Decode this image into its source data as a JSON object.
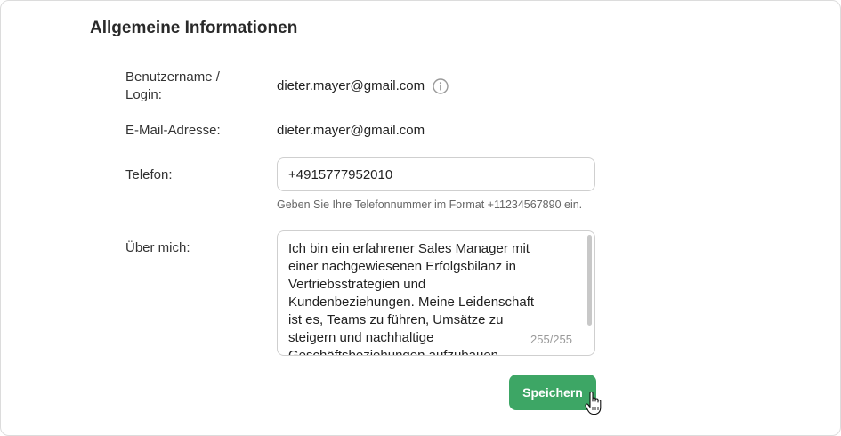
{
  "section": {
    "title": "Allgemeine Informationen"
  },
  "fields": {
    "username": {
      "label_line1": "Benutzername /",
      "label_line2": "Login:",
      "value": "dieter.mayer@gmail.com"
    },
    "email": {
      "label": "E-Mail-Adresse:",
      "value": "dieter.mayer@gmail.com"
    },
    "phone": {
      "label": "Telefon:",
      "value": "+4915777952010",
      "hint": "Geben Sie Ihre Telefonnummer im Format +11234567890 ein."
    },
    "about": {
      "label": "Über mich:",
      "value": "Ich bin ein erfahrener Sales Manager mit einer nachgewiesenen Erfolgsbilanz in Vertriebsstrategien und Kundenbeziehungen. Meine Leidenschaft ist es, Teams zu führen, Umsätze zu steigern und nachhaltige Geschäftsbeziehungen aufzubauen.",
      "counter": "255/255"
    }
  },
  "actions": {
    "save_label": "Speichern"
  },
  "icons": {
    "info": "info-circle-icon",
    "cursor": "hand-pointer-icon"
  },
  "colors": {
    "accent": "#3da665"
  }
}
